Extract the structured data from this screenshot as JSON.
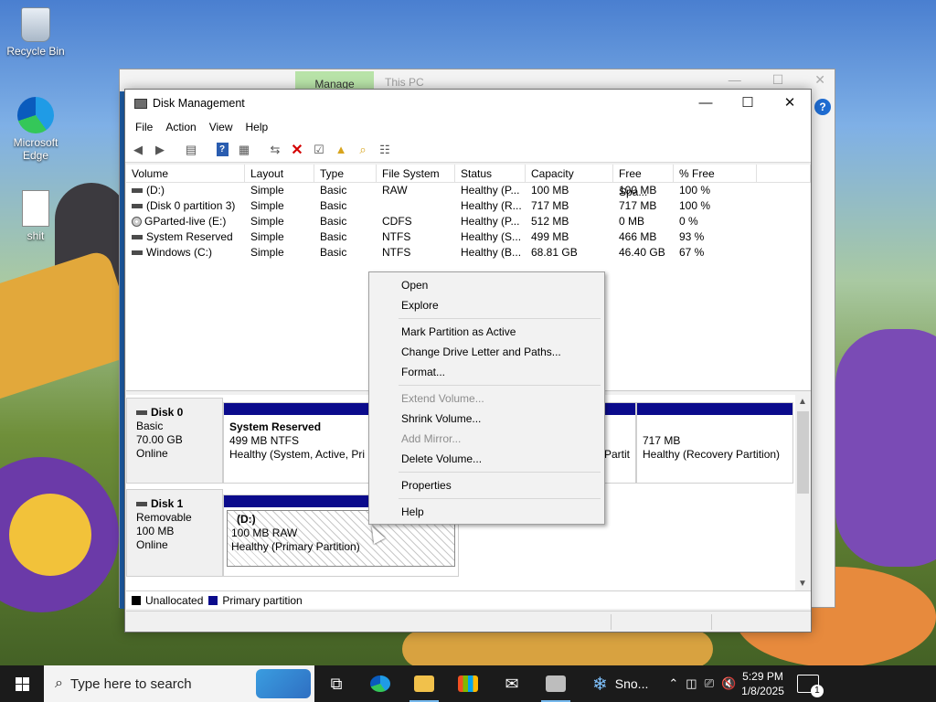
{
  "desktop": {
    "icons": [
      {
        "label": "Recycle Bin",
        "icon": "recycle-bin-icon"
      },
      {
        "label": "Microsoft Edge",
        "icon": "edge-icon"
      },
      {
        "label": "shit",
        "icon": "text-file-icon"
      }
    ]
  },
  "back_window": {
    "manage_tab": "Manage",
    "title": "This PC"
  },
  "window": {
    "title": "Disk Management",
    "menu": [
      "File",
      "Action",
      "View",
      "Help"
    ]
  },
  "volume_table": {
    "columns": [
      "Volume",
      "Layout",
      "Type",
      "File System",
      "Status",
      "Capacity",
      "Free Spa...",
      "% Free"
    ],
    "rows": [
      {
        "volume": "(D:)",
        "layout": "Simple",
        "type": "Basic",
        "fs": "RAW",
        "status": "Healthy (P...",
        "capacity": "100 MB",
        "free": "100 MB",
        "pct": "100 %",
        "icon": "drive-icon"
      },
      {
        "volume": "(Disk 0 partition 3)",
        "layout": "Simple",
        "type": "Basic",
        "fs": "",
        "status": "Healthy (R...",
        "capacity": "717 MB",
        "free": "717 MB",
        "pct": "100 %",
        "icon": "drive-icon"
      },
      {
        "volume": "GParted-live (E:)",
        "layout": "Simple",
        "type": "Basic",
        "fs": "CDFS",
        "status": "Healthy (P...",
        "capacity": "512 MB",
        "free": "0 MB",
        "pct": "0 %",
        "icon": "cd-drive-icon"
      },
      {
        "volume": "System Reserved",
        "layout": "Simple",
        "type": "Basic",
        "fs": "NTFS",
        "status": "Healthy (S...",
        "capacity": "499 MB",
        "free": "466 MB",
        "pct": "93 %",
        "icon": "drive-icon"
      },
      {
        "volume": "Windows (C:)",
        "layout": "Simple",
        "type": "Basic",
        "fs": "NTFS",
        "status": "Healthy (B...",
        "capacity": "68.81 GB",
        "free": "46.40 GB",
        "pct": "67 %",
        "icon": "drive-icon"
      }
    ]
  },
  "disks": [
    {
      "name": "Disk 0",
      "type": "Basic",
      "size": "70.00 GB",
      "state": "Online",
      "partitions": [
        {
          "name": "System Reserved",
          "line2": "499 MB NTFS",
          "line3": "Healthy (System, Active, Pri"
        },
        {
          "name": "",
          "line2": "",
          "line3": "Partit"
        },
        {
          "name": "",
          "line2": "717 MB",
          "line3": "Healthy (Recovery Partition)"
        }
      ]
    },
    {
      "name": "Disk 1",
      "type": "Removable",
      "size": "100 MB",
      "state": "Online",
      "partitions": [
        {
          "name": "(D:)",
          "line2": "100 MB RAW",
          "line3": "Healthy (Primary Partition)"
        }
      ]
    }
  ],
  "legend": [
    {
      "label": "Unallocated",
      "color": "#000000"
    },
    {
      "label": "Primary partition",
      "color": "#0b0b8c"
    }
  ],
  "context_menu": {
    "items": [
      {
        "label": "Open",
        "enabled": true
      },
      {
        "label": "Explore",
        "enabled": true
      },
      {
        "label": "Mark Partition as Active",
        "enabled": true
      },
      {
        "label": "Change Drive Letter and Paths...",
        "enabled": true
      },
      {
        "label": "Format...",
        "enabled": true
      },
      {
        "label": "Extend Volume...",
        "enabled": false
      },
      {
        "label": "Shrink Volume...",
        "enabled": true
      },
      {
        "label": "Add Mirror...",
        "enabled": false
      },
      {
        "label": "Delete Volume...",
        "enabled": true
      },
      {
        "label": "Properties",
        "enabled": true
      },
      {
        "label": "Help",
        "enabled": true
      }
    ]
  },
  "taskbar": {
    "search_placeholder": "Type here to search",
    "weather": "Sno...",
    "time": "5:29 PM",
    "date": "1/8/2025",
    "notification_count": "1"
  },
  "colors": {
    "primary_partition": "#0b0b8c",
    "taskbar_bg": "#1b1b1b",
    "manage_tab": "#b8e3a8"
  }
}
